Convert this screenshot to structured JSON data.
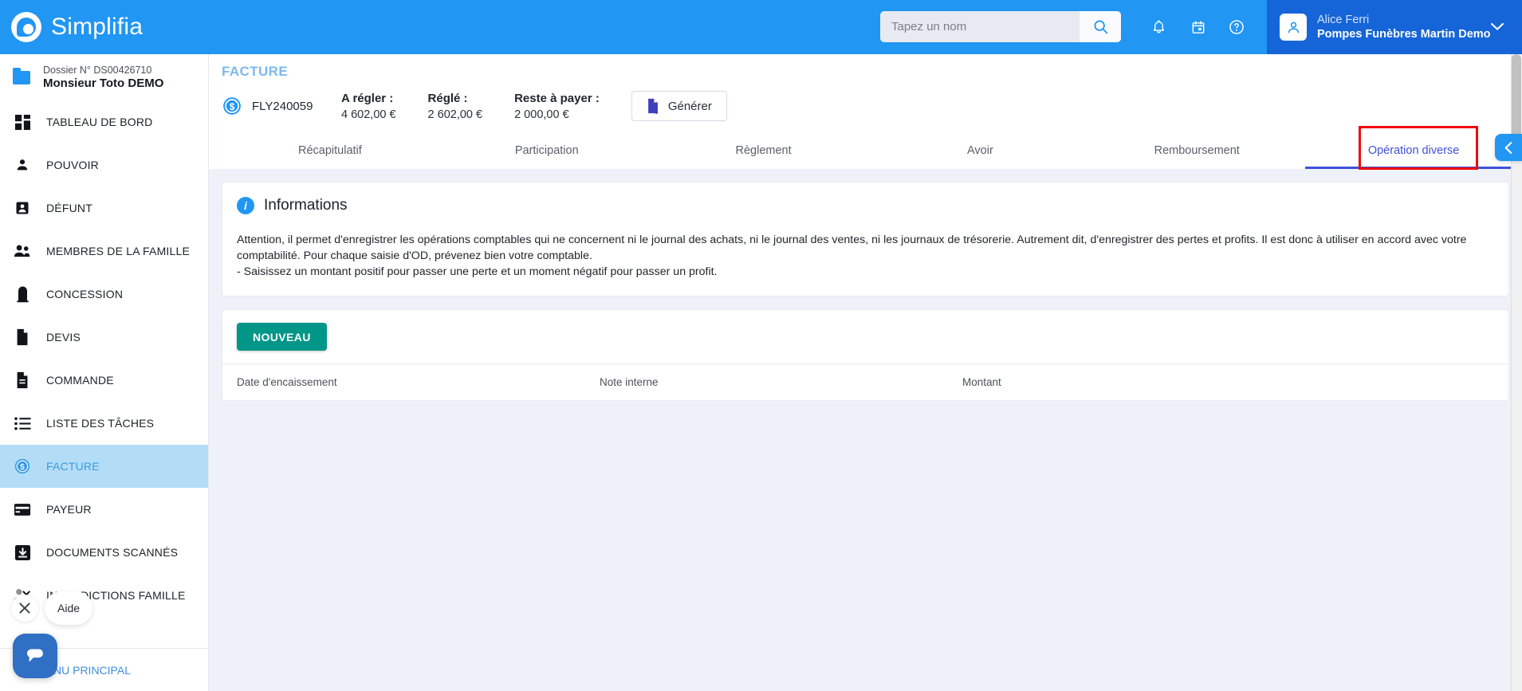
{
  "app": {
    "brand": "Simplifia",
    "logo_icon": "simplifia-logo-icon"
  },
  "header": {
    "search": {
      "placeholder": "Tapez un nom",
      "value": "",
      "icon": "search-icon"
    },
    "icons": [
      {
        "name": "notifications-bell-icon"
      },
      {
        "name": "calendar-icon"
      },
      {
        "name": "help-circle-icon"
      }
    ],
    "user": {
      "name": "Alice Ferri",
      "org": "Pompes Funèbres Martin Demo",
      "avatar_icon": "user-avatar-icon",
      "caret_icon": "chevron-down-icon"
    }
  },
  "sidebar": {
    "dossier": {
      "number": "Dossier N° DS00426710",
      "name": "Monsieur Toto DEMO",
      "icon": "folder-icon"
    },
    "items": [
      {
        "label": "TABLEAU DE BORD",
        "icon": "dashboard-icon",
        "active": false
      },
      {
        "label": "POUVOIR",
        "icon": "person-icon",
        "active": false
      },
      {
        "label": "DÉFUNT",
        "icon": "badge-person-icon",
        "active": false
      },
      {
        "label": "MEMBRES DE LA FAMILLE",
        "icon": "people-group-icon",
        "active": false
      },
      {
        "label": "CONCESSION",
        "icon": "tombstone-icon",
        "active": false
      },
      {
        "label": "DEVIS",
        "icon": "document-icon",
        "active": false
      },
      {
        "label": "COMMANDE",
        "icon": "document-lines-icon",
        "active": false
      },
      {
        "label": "LISTE DES TÂCHES",
        "icon": "list-icon",
        "active": false
      },
      {
        "label": "FACTURE",
        "icon": "coin-dollar-icon",
        "active": true
      },
      {
        "label": "PAYEUR",
        "icon": "credit-card-icon",
        "active": false
      },
      {
        "label": "DOCUMENTS SCANNÉS",
        "icon": "download-box-icon",
        "active": false
      },
      {
        "label": "INTERDICTIONS FAMILLE",
        "icon": "person-remove-icon",
        "active": false
      }
    ],
    "footer": {
      "label": "MENU PRINCIPAL",
      "icon": "chevron-left-icon"
    }
  },
  "chat_widget": {
    "tooltip": "Aide",
    "close_icon": "close-icon",
    "bubble_icon": "chat-bubble-icon"
  },
  "main": {
    "page_title": "FACTURE",
    "invoice": {
      "number": "FLY240059",
      "icon": "coin-dollar-icon",
      "amounts": [
        {
          "label": "A régler :",
          "value": "4 602,00 €"
        },
        {
          "label": "Réglé :",
          "value": "2 602,00 €"
        },
        {
          "label": "Reste à payer :",
          "value": "2 000,00 €"
        }
      ],
      "generate_button": {
        "label": "Générer",
        "icon": "file-generate-icon"
      }
    },
    "tabs": [
      {
        "label": "Récapitulatif",
        "active": false
      },
      {
        "label": "Participation",
        "active": false
      },
      {
        "label": "Règlement",
        "active": false
      },
      {
        "label": "Avoir",
        "active": false
      },
      {
        "label": "Remboursement",
        "active": false
      },
      {
        "label": "Opération diverse",
        "active": true
      }
    ],
    "info_panel": {
      "icon": "info-icon",
      "title": "Informations",
      "paragraph_1": "Attention, il permet d'enregistrer les opérations comptables qui ne concernent ni le journal des achats, ni le journal des ventes, ni les journaux de trésorerie. Autrement dit, d'enregistrer des pertes et profits. Il est donc à utiliser en accord avec votre comptabilité. Pour chaque saisie d'OD, prévenez bien votre comptable.",
      "paragraph_2": "- Saisissez un montant positif pour passer une perte et un moment négatif pour passer un profit."
    },
    "table_card": {
      "new_button": "NOUVEAU",
      "columns": [
        "Date d'encaissement",
        "Note interne",
        "Montant"
      ],
      "rows": []
    },
    "collapse_button": {
      "icon": "chevron-left-icon"
    }
  },
  "colors": {
    "brand_blue": "#2196f3",
    "user_blue": "#1565d8",
    "active_tab": "#3f51d8",
    "teal_button": "#009688",
    "marker_red": "#f10b0b",
    "content_bg": "#eef1f8"
  }
}
